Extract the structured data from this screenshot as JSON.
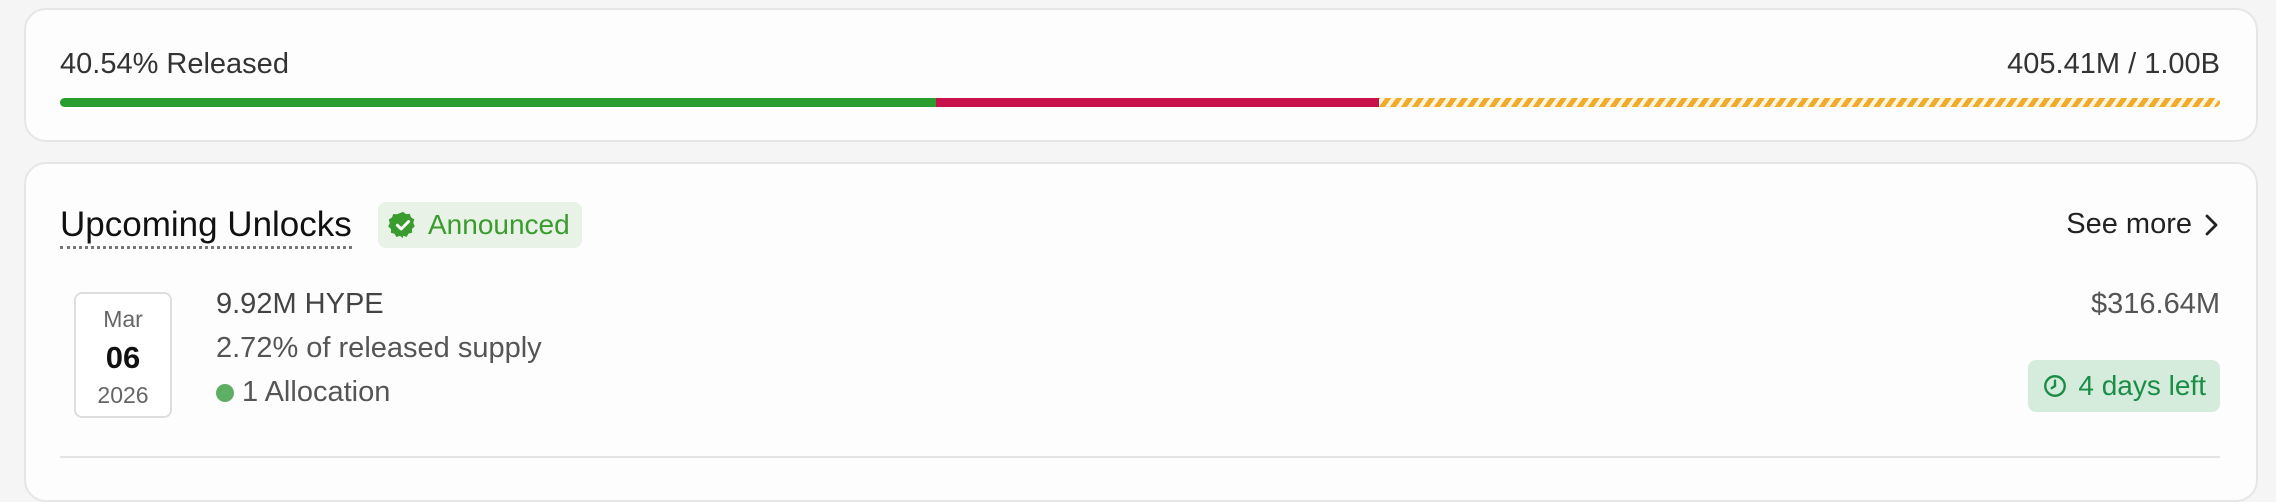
{
  "release": {
    "percent_label": "40.54% Released",
    "total_label": "405.41M / 1.00B",
    "progress": {
      "released_fraction": 0.4054,
      "locked_fraction": 0.2054,
      "pending_fraction": 0.3892,
      "colors": {
        "released": "#2a9d2f",
        "locked": "#c8124b",
        "pending": "#f0aa2c"
      }
    }
  },
  "unlocks": {
    "title": "Upcoming Unlocks",
    "badge": {
      "label": "Announced",
      "icon": "verified-check-icon",
      "color": "#3a9b2e"
    },
    "see_more_label": "See more",
    "items": [
      {
        "date": {
          "month": "Mar",
          "day": "06",
          "year": "2026"
        },
        "amount": "9.92M HYPE",
        "share": "2.72% of released supply",
        "allocation": "1 Allocation",
        "value": "$316.64M",
        "time_left": "4 days left",
        "time_icon": "clock-icon"
      }
    ]
  }
}
